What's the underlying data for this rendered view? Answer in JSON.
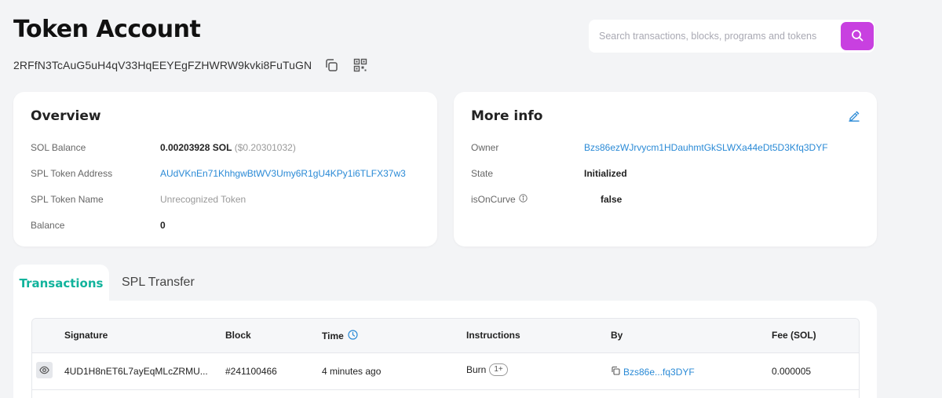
{
  "page": {
    "title": "Token Account",
    "address": "2RFfN3TcAuG5uH4qV33HqEEYEgFZHWRW9kvki8FuTuGN"
  },
  "search": {
    "placeholder": "Search transactions, blocks, programs and tokens"
  },
  "overview": {
    "title": "Overview",
    "fields": [
      {
        "label": "SOL Balance",
        "value": "0.00203928 SOL",
        "extra": "($0.20301032)"
      },
      {
        "label": "SPL Token Address",
        "value": "AUdVKnEn71KhhgwBtWV3Umy6R1gU4KPy1i6TLFX37w3"
      },
      {
        "label": "SPL Token Name",
        "value": "Unrecognized Token"
      },
      {
        "label": "Balance",
        "value": "0"
      }
    ]
  },
  "more_info": {
    "title": "More info",
    "fields": [
      {
        "label": "Owner",
        "value": "Bzs86ezWJrvycm1HDauhmtGkSLWXa44eDt5D3Kfq3DYF"
      },
      {
        "label": "State",
        "value": "Initialized"
      },
      {
        "label": "isOnCurve",
        "value": "false"
      }
    ]
  },
  "tabs": [
    {
      "label": "Transactions",
      "active": true
    },
    {
      "label": "SPL Transfer",
      "active": false
    }
  ],
  "table": {
    "headers": [
      "Signature",
      "Block",
      "Time",
      "Instructions",
      "By",
      "Fee (SOL)"
    ],
    "rows": [
      {
        "signature": "4UD1H8nET6L7ayEqMLcZRMU...",
        "block": "#241100466",
        "time": "4 minutes ago",
        "instruction": "Burn",
        "instruction_badge": "1+",
        "by": "Bzs86e...fq3DYF",
        "fee": "0.000005"
      }
    ]
  },
  "colors": {
    "accent": "#c840e0",
    "link": "#2a8ad6",
    "tab_active": "#11b39c"
  }
}
